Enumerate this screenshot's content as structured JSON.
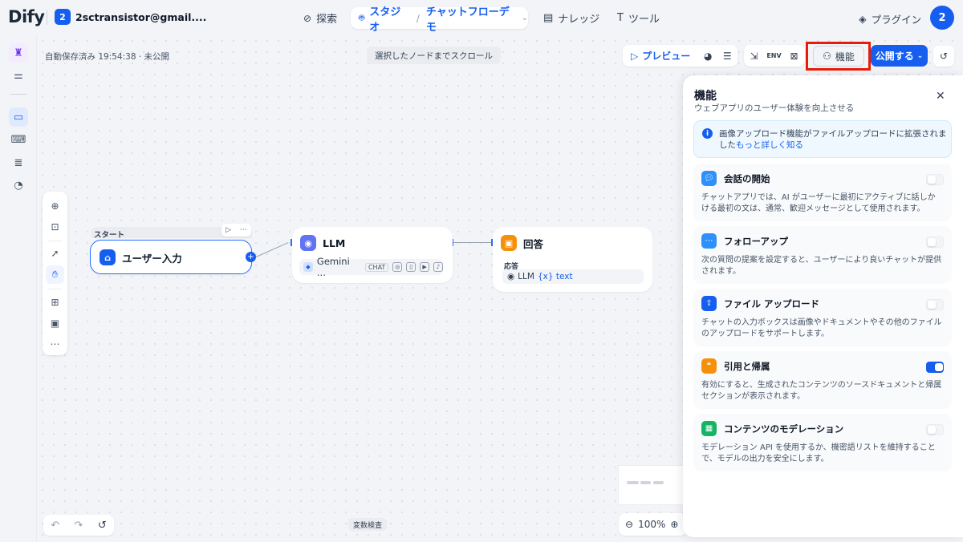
{
  "nav": {
    "logo_part1": "D",
    "logo_part2": "i",
    "logo_part3": "fy",
    "workspace_badge": "2",
    "workspace_name": "2sctransistor@gmail....",
    "explore": "探索",
    "studio": "スタジオ",
    "app_name": "チャットフローデモ",
    "knowledge": "ナレッジ",
    "tools": "ツール",
    "plugins": "プラグイン",
    "avatar": "2"
  },
  "canvas": {
    "autosave": "自動保存済み 19:54:38 · 未公開",
    "scroll_to_selected": "選択したノードまでスクロール",
    "variable_inspect": "変数検査",
    "zoom": "100%"
  },
  "toolbar": {
    "preview": "プレビュー",
    "features": "機能",
    "publish": "公開する"
  },
  "nodes": {
    "start_label": "スタート",
    "start_title": "ユーザー入力",
    "llm_title": "LLM",
    "llm_model": "Gemini ...",
    "llm_mode": "CHAT",
    "answer_title": "回答",
    "answer_label": "応答",
    "answer_source": "LLM",
    "answer_var": "{x} text"
  },
  "panel": {
    "title": "機能",
    "subtitle": "ウェブアプリのユーザー体験を向上させる",
    "info_text": "画像アップロード機能がファイルアップロードに拡張されました",
    "info_link": "もっと詳しく知る",
    "features": [
      {
        "name": "会話の開始",
        "desc": "チャットアプリでは、AI がユーザーに最初にアクティブに話しかける最初の文は、通常、歓迎メッセージとして使用されます。",
        "enabled": false,
        "color": "#2e90fa"
      },
      {
        "name": "フォローアップ",
        "desc": "次の質問の提案を設定すると、ユーザーにより良いチャットが提供されます。",
        "enabled": false,
        "color": "#2e90fa"
      },
      {
        "name": "ファイル アップロード",
        "desc": "チャットの入力ボックスは画像やドキュメントやその他のファイルのアップロードをサポートします。",
        "enabled": false,
        "color": "#155eef"
      },
      {
        "name": "引用と帰属",
        "desc": "有効にすると、生成されたコンテンツのソースドキュメントと帰属セクションが表示されます。",
        "enabled": true,
        "color": "#f79009"
      },
      {
        "name": "コンテンツのモデレーション",
        "desc": "モデレーション API を使用するか、機密語リストを維持することで、モデルの出力を安全にします。",
        "enabled": false,
        "color": "#16b364"
      }
    ]
  },
  "colors": {
    "accent": "#155eef",
    "highlight": "#ea1c08"
  }
}
